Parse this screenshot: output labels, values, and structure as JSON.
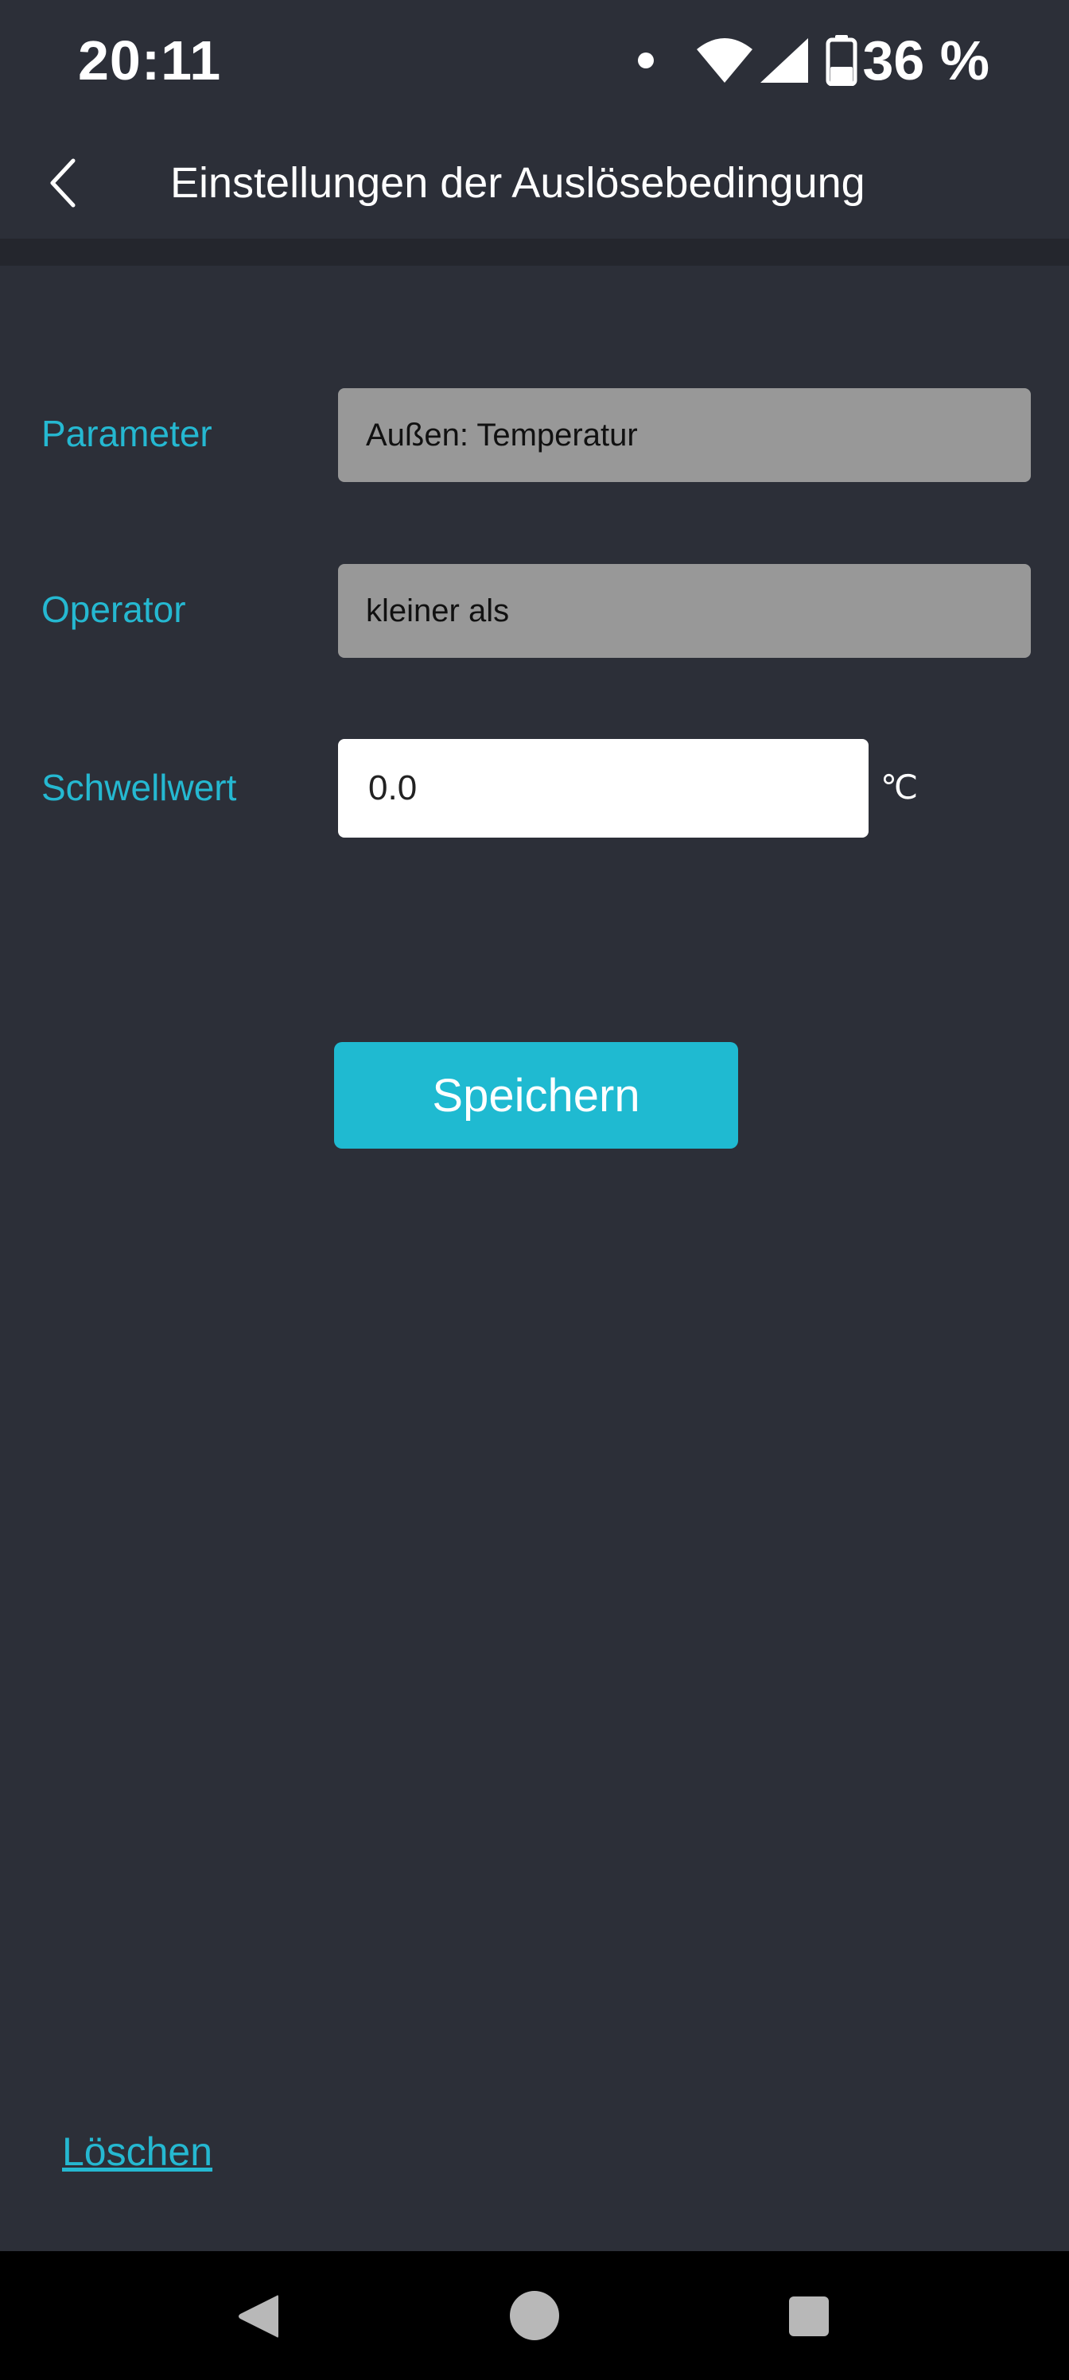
{
  "status_bar": {
    "time": "20:11",
    "battery_text": "36 %",
    "icons": [
      "notification-dot-icon",
      "wifi-icon",
      "cell-signal-icon",
      "battery-icon"
    ]
  },
  "header": {
    "back_icon": "chevron-left-icon",
    "title": "Einstellungen der Auslösebedingung"
  },
  "form": {
    "parameter": {
      "label": "Parameter",
      "value": "Außen: Temperatur"
    },
    "operator": {
      "label": "Operator",
      "value": "kleiner als"
    },
    "threshold": {
      "label": "Schwellwert",
      "value": "0.0",
      "unit": "℃"
    }
  },
  "actions": {
    "save_label": "Speichern",
    "delete_label": "Löschen"
  },
  "nav_bar": {
    "icons": [
      "nav-back-icon",
      "nav-home-icon",
      "nav-recents-icon"
    ]
  },
  "colors": {
    "background": "#2c2f38",
    "accent": "#1fbad1",
    "label": "#25b8d1",
    "select_bg": "#989898"
  }
}
